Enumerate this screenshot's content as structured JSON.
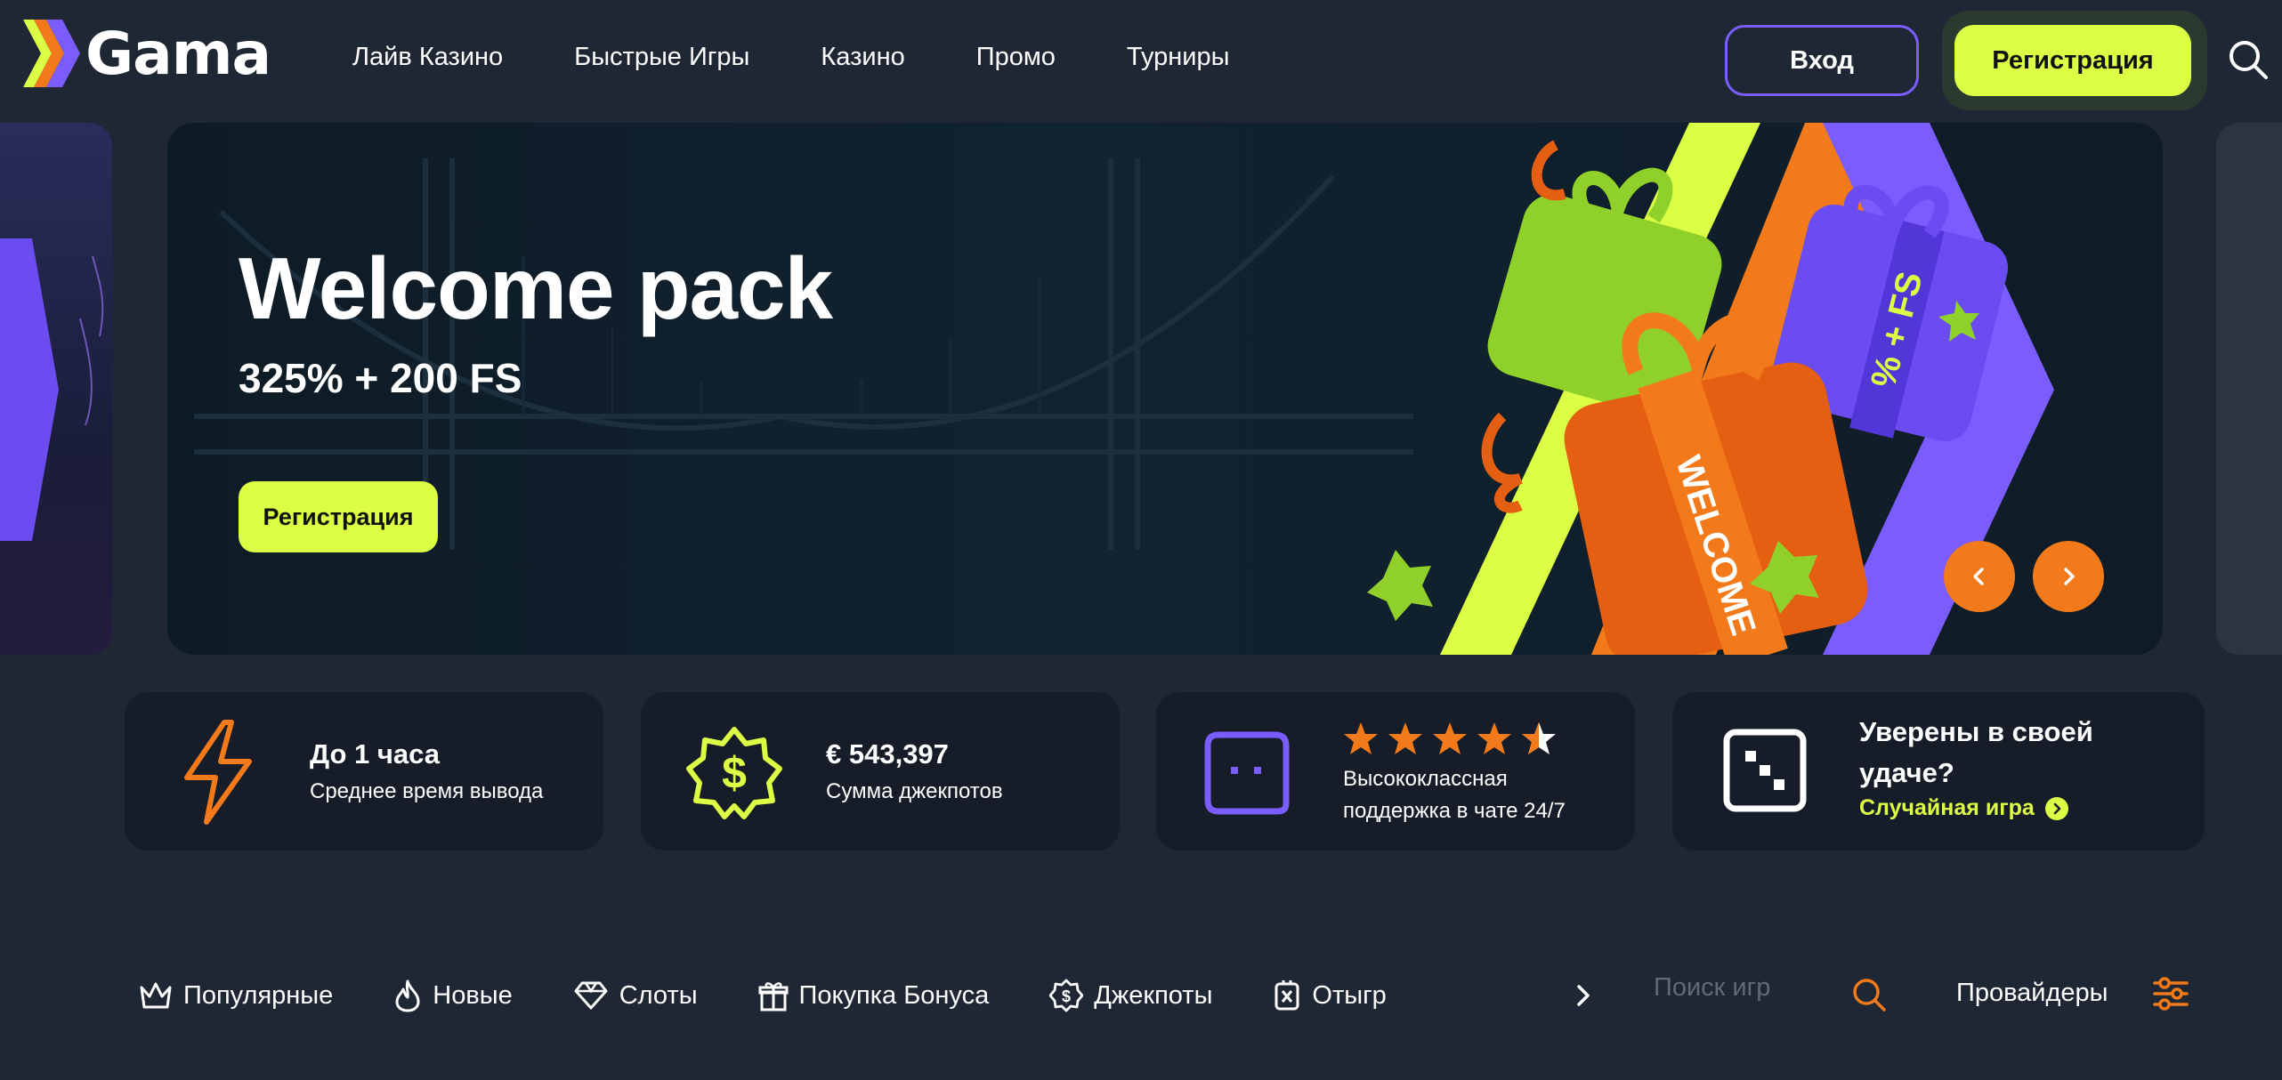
{
  "header": {
    "logo_text": "Gama",
    "nav": [
      {
        "label": "Лайв Казино"
      },
      {
        "label": "Быстрые Игры"
      },
      {
        "label": "Казино"
      },
      {
        "label": "Промо"
      },
      {
        "label": "Турниры"
      }
    ],
    "login_label": "Вход",
    "register_label": "Регистрация",
    "search_icon": "search-icon"
  },
  "hero": {
    "title": "Welcome pack",
    "subtitle": "325% + 200 FS",
    "button_label": "Регистрация",
    "gift_text_1": "WELCOME",
    "gift_text_2": "% + FS"
  },
  "features": [
    {
      "icon": "lightning-icon",
      "title": "До 1 часа",
      "subtitle": "Среднее время вывода"
    },
    {
      "icon": "dollar-badge-icon",
      "title": "€  543,397",
      "subtitle": "Сумма джекпотов"
    },
    {
      "icon": "chat-icon",
      "rating": 4.5,
      "rating_max": 5,
      "subtitle": "Высококлассная поддержка в чате 24/7"
    },
    {
      "icon": "dice-icon",
      "title": "Уверены в своей удаче?",
      "link": "Случайная игра"
    }
  ],
  "categories": [
    {
      "icon": "crown-icon",
      "label": "Популярные"
    },
    {
      "icon": "fire-icon",
      "label": "Новые"
    },
    {
      "icon": "diamond-icon",
      "label": "Слоты"
    },
    {
      "icon": "gift-icon",
      "label": "Покупка Бонуса"
    },
    {
      "icon": "jackpot-icon",
      "label": "Джекпоты"
    },
    {
      "icon": "ticket-icon",
      "label": "Отыгрыш"
    }
  ],
  "search": {
    "placeholder": "Поиск игр"
  },
  "providers_label": "Провайдеры",
  "colors": {
    "background": "#1e2733",
    "accent_lime": "#dbff45",
    "accent_purple": "#7b5cff",
    "accent_orange": "#f27a1a",
    "card_bg": "#161d28"
  }
}
